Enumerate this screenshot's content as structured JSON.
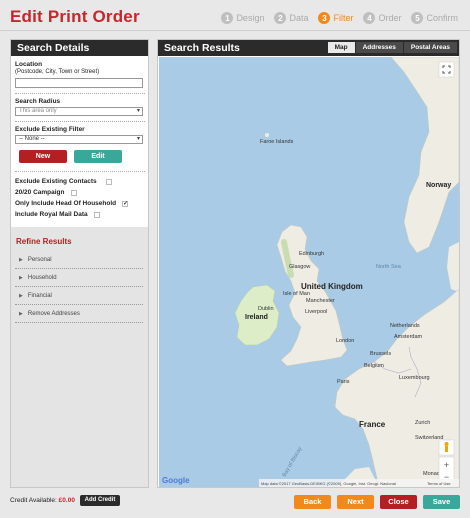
{
  "header": {
    "title": "Edit Print Order",
    "steps": [
      {
        "num": "1",
        "label": "Design",
        "state": "inactive"
      },
      {
        "num": "2",
        "label": "Data",
        "state": "inactive"
      },
      {
        "num": "3",
        "label": "Filter",
        "state": "active"
      },
      {
        "num": "4",
        "label": "Order",
        "state": "inactive"
      },
      {
        "num": "5",
        "label": "Confirm",
        "state": "inactive"
      }
    ]
  },
  "search": {
    "panel_title": "Search Details",
    "location_label": "Location",
    "location_hint": "(Postcode, City, Town or Street)",
    "location_value": "",
    "radius_label": "Search Radius",
    "radius_value": "This area only",
    "exclude_filter_label": "Exclude Existing Filter",
    "exclude_filter_value": "-- None --",
    "new_button": "New",
    "edit_button": "Edit",
    "options": [
      {
        "label": "Exclude Existing Contacts",
        "checked": false
      },
      {
        "label": "20/20 Campaign",
        "checked": false
      },
      {
        "label": "Only Include Head Of Household",
        "checked": true
      },
      {
        "label": "Include Royal Mail Data",
        "checked": false
      }
    ]
  },
  "refine": {
    "title": "Refine Results",
    "items": [
      "Personal",
      "Household",
      "Financial",
      "Remove Addresses"
    ]
  },
  "results": {
    "panel_title": "Search Results",
    "tabs": [
      {
        "label": "Map",
        "active": true
      },
      {
        "label": "Addresses",
        "active": false
      },
      {
        "label": "Postal Areas",
        "active": false
      }
    ]
  },
  "map": {
    "labels": [
      "Faroe Islands",
      "Edinburgh",
      "Glasgow",
      "United Kingdom",
      "Isle of Man",
      "Manchester",
      "Liverpool",
      "Dublin",
      "Ireland",
      "London",
      "Netherlands",
      "Amsterdam",
      "Brussels",
      "Belgium",
      "Paris",
      "France",
      "Luxembourg",
      "Zurich",
      "Switzerland",
      "Bay of Biscay",
      "Norway",
      "Monaco",
      "North Sea"
    ],
    "attribution": "Map data ©2017 GeoBasis-DE/BKG (©2009), Google, Inst. Geogr. Nacional",
    "terms": "Terms of Use",
    "google": "Google"
  },
  "footer": {
    "credit_label": "Credit Available:",
    "credit_value": "£0.00",
    "add_credit": "Add Credit",
    "back": "Back",
    "next": "Next",
    "close": "Close",
    "save": "Save"
  },
  "colors": {
    "brand_red": "#c7262c",
    "orange": "#f08a1c",
    "teal": "#3aa79b",
    "sea": "#a9cbe5",
    "land": "#eeece3",
    "ireland_land": "#dcedc8"
  }
}
